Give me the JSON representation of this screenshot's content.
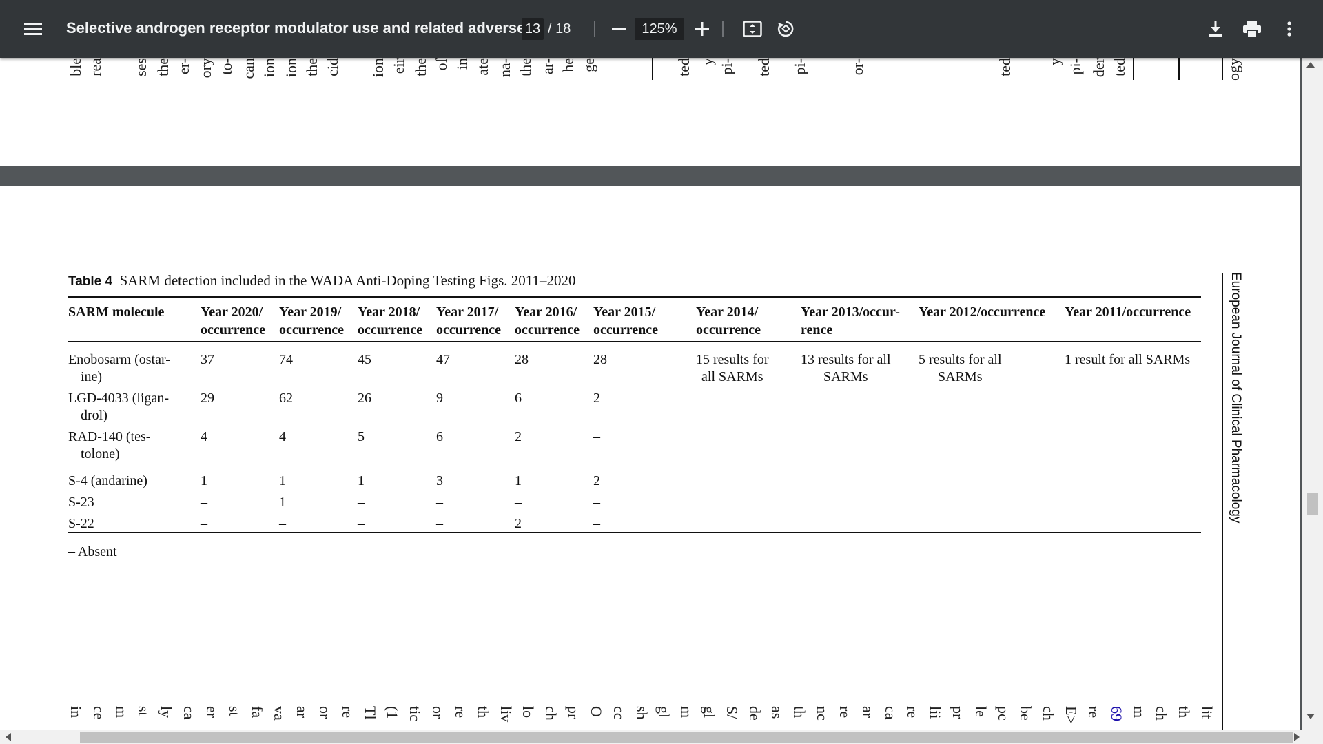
{
  "toolbar": {
    "title": "Selective androgen receptor modulator use and related adverse ...",
    "page_current": "13",
    "page_total": "/ 18",
    "zoom": "125%"
  },
  "icons": [
    "menu-icon",
    "zoom-out-icon",
    "zoom-in-icon",
    "fit-page-icon",
    "rotate-icon",
    "download-icon",
    "print-icon",
    "more-vert-icon"
  ],
  "page_top_fragments": [
    "ble",
    "rea",
    "ses",
    "the",
    "er-",
    "ory",
    "to-",
    "can",
    "ion",
    "ion",
    "the",
    "cid",
    "ion",
    "eir",
    "the",
    "of",
    "in",
    "ate",
    "na-",
    "the",
    "ar-",
    "he",
    "ge",
    "ted",
    "y",
    "pi-",
    "ted",
    "pi-",
    "or-",
    "ted",
    "y",
    "pi-",
    "der",
    "ted",
    "ogy"
  ],
  "table": {
    "caption_label": "Table 4",
    "caption_text": "SARM detection included in the WADA Anti-Doping Testing Figs. 2011–2020",
    "headers": [
      [
        "SARM molecule",
        ""
      ],
      [
        "Year 2020/",
        "occurrence"
      ],
      [
        "Year 2019/",
        "occurrence"
      ],
      [
        "Year 2018/",
        "occurrence"
      ],
      [
        "Year 2017/",
        "occurrence"
      ],
      [
        "Year 2016/",
        "occurrence"
      ],
      [
        "Year 2015/",
        "occurrence"
      ],
      [
        "Year 2014/",
        "occurrence"
      ],
      [
        "Year 2013/occur-",
        "rence"
      ],
      [
        "Year 2012/occurrence",
        ""
      ],
      [
        "Year 2011/occurrence",
        ""
      ]
    ],
    "rows": [
      {
        "molecule": [
          "Enobosarm (ostar-",
          "ine)"
        ],
        "values": [
          "37",
          "74",
          "45",
          "47",
          "28",
          "28"
        ]
      },
      {
        "molecule": [
          "LGD-4033 (ligan-",
          "drol)"
        ],
        "values": [
          "29",
          "62",
          "26",
          "9",
          "6",
          "2"
        ]
      },
      {
        "molecule": [
          "RAD-140 (tes-",
          "tolone)"
        ],
        "values": [
          "4",
          "4",
          "5",
          "6",
          "2",
          "–"
        ]
      },
      {
        "molecule": [
          "S-4 (andarine)",
          ""
        ],
        "values": [
          "1",
          "1",
          "1",
          "3",
          "1",
          "2"
        ]
      },
      {
        "molecule": [
          "S-23",
          ""
        ],
        "values": [
          "–",
          "1",
          "–",
          "–",
          "–",
          "–"
        ]
      },
      {
        "molecule": [
          "S-22",
          ""
        ],
        "values": [
          "–",
          "–",
          "–",
          "–",
          "2",
          "–"
        ]
      }
    ],
    "aggregate": [
      [
        "15 results for",
        "all SARMs"
      ],
      [
        "13 results for all",
        "SARMs"
      ],
      [
        "5 results for all",
        "SARMs"
      ],
      [
        "1 result for all SARMs",
        ""
      ]
    ],
    "footnote": "– Absent"
  },
  "journal_label": "European Journal of Clinical Pharmacology",
  "page_bottom_fragments": [
    "in",
    "ce",
    "m",
    "st",
    "ly",
    "ca",
    "er",
    "st",
    "fa",
    "va",
    "ar",
    "or",
    "re",
    "Tl",
    "(1",
    "tic",
    "or",
    "re",
    "th",
    "liv",
    "lo",
    "ch",
    "pr",
    "O",
    "cc",
    "sh",
    "gl",
    "m",
    "gl",
    "S/",
    "de",
    "as",
    "th",
    "nc",
    "re",
    "ar",
    "ca",
    "re",
    "lii",
    "pr",
    "le",
    "pc",
    "be",
    "ch",
    "E>",
    "re",
    "69",
    "m",
    "ch",
    "th",
    "lit"
  ],
  "link_color": "#1a0dab"
}
